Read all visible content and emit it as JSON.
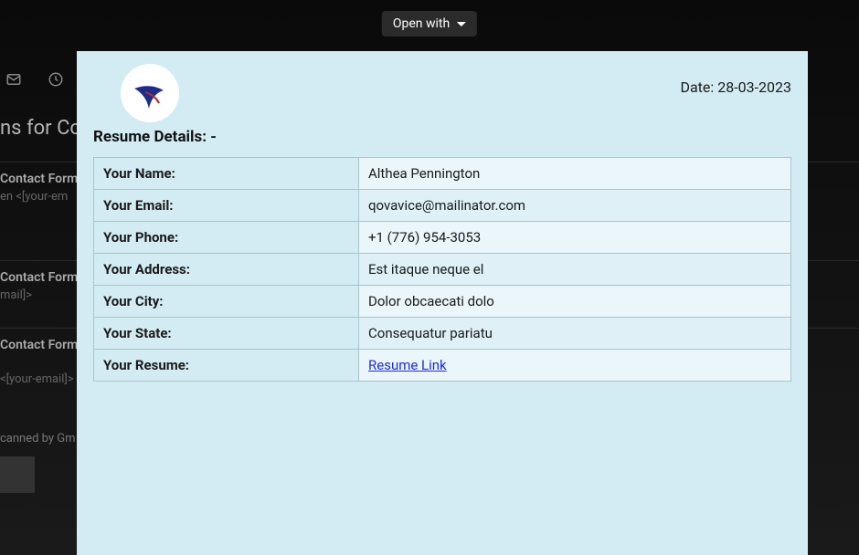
{
  "toolbar": {
    "open_with": "Open with"
  },
  "backdrop": {
    "title_partial": "ns for Co",
    "rows": [
      {
        "label": "Contact Form",
        "sub": "en <[your-em"
      },
      {
        "label": "Contact Form",
        "sub": "mail]>"
      },
      {
        "label": "Contact Form",
        "sub": "<[your-email]>"
      }
    ],
    "scanned": "canned by Gm"
  },
  "document": {
    "date_prefix": "Date: ",
    "date_value": "28-03-2023",
    "heading": "Resume Details: -",
    "fields": [
      {
        "label": "Your Name:",
        "value": "Althea Pennington"
      },
      {
        "label": "Your Email:",
        "value": "qovavice@mailinator.com"
      },
      {
        "label": "Your Phone:",
        "value": "+1 (776) 954-3053"
      },
      {
        "label": "Your Address:",
        "value": "Est itaque neque el"
      },
      {
        "label": "Your City:",
        "value": "Dolor obcaecati dolo"
      },
      {
        "label": "Your State:",
        "value": "Consequatur pariatu"
      }
    ],
    "resume_field_label": "Your Resume:",
    "resume_link_text": "Resume Link"
  }
}
